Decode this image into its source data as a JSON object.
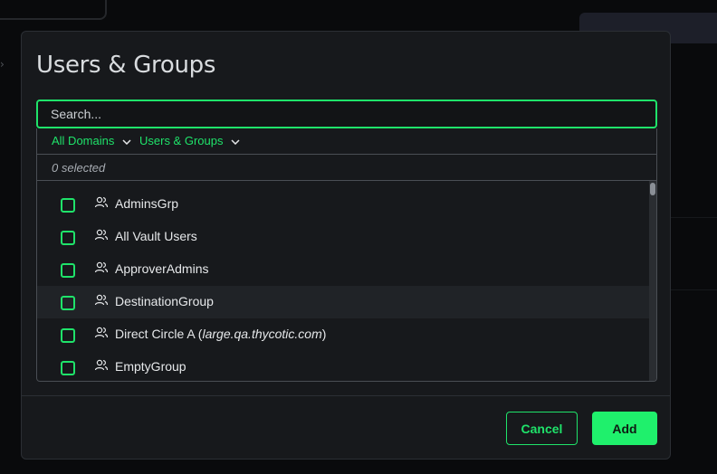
{
  "dialog": {
    "title": "Users & Groups",
    "search": {
      "placeholder": "Search...",
      "value": ""
    },
    "filters": [
      {
        "label": "All Domains",
        "icon": "chevron-down-icon"
      },
      {
        "label": "Users & Groups",
        "icon": "chevron-down-icon"
      }
    ],
    "selected_count": "0 selected",
    "items": [
      {
        "name": "AdminsGrp",
        "domain": "",
        "checked": false,
        "icon": "users-icon"
      },
      {
        "name": "All Vault Users",
        "domain": "",
        "checked": false,
        "icon": "users-icon"
      },
      {
        "name": "ApproverAdmins",
        "domain": "",
        "checked": false,
        "icon": "users-icon"
      },
      {
        "name": "DestinationGroup",
        "domain": "",
        "checked": false,
        "icon": "users-icon"
      },
      {
        "name": "Direct Circle A (",
        "domain": "large.qa.thycotic.com",
        "suffix": ")",
        "checked": false,
        "icon": "users-icon"
      },
      {
        "name": "EmptyGroup",
        "domain": "",
        "checked": false,
        "icon": "users-icon"
      }
    ],
    "buttons": {
      "cancel": "Cancel",
      "add": "Add"
    }
  },
  "colors": {
    "accent": "#1fe36a",
    "modal_bg": "#17191c",
    "page_bg": "#0e1013"
  }
}
